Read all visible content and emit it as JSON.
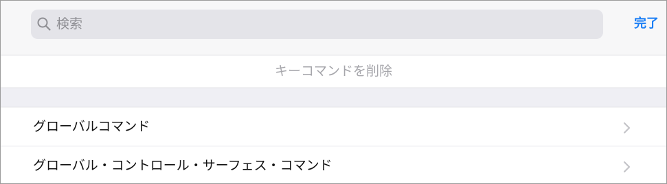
{
  "search": {
    "placeholder": "検索",
    "done_label": "完了"
  },
  "actions": {
    "delete_key_command": "キーコマンドを削除"
  },
  "list": {
    "items": [
      {
        "label": "グローバルコマンド",
        "icon": "chevron-right-icon"
      },
      {
        "label": "グローバル・コントロール・サーフェス・コマンド",
        "icon": "chevron-right-icon"
      }
    ]
  },
  "colors": {
    "accent": "#1a7ef5",
    "background": "#efeff4",
    "search_field": "#e4e4e9",
    "disabled_text": "#a6a6ab"
  }
}
